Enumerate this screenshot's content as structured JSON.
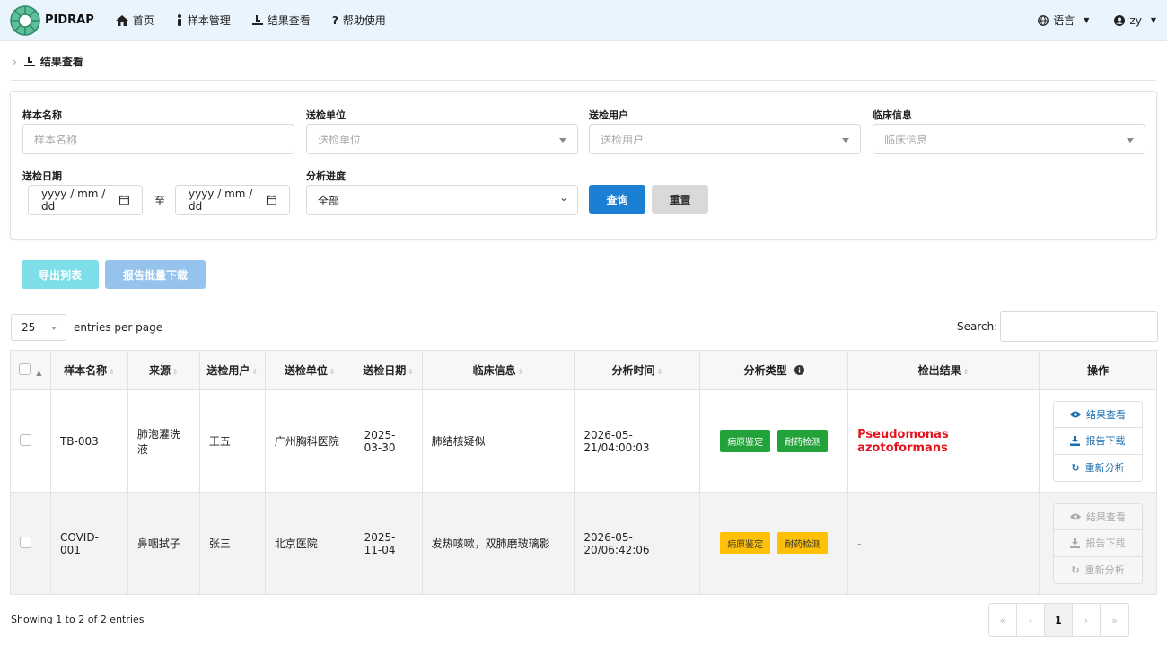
{
  "app": {
    "brand": "PIDRAP"
  },
  "nav": {
    "items": [
      {
        "label": "首页",
        "icon": "home-icon"
      },
      {
        "label": "样本管理",
        "icon": "sample-icon"
      },
      {
        "label": "结果查看",
        "icon": "result-icon"
      },
      {
        "label": "帮助使用",
        "icon": "help-icon"
      }
    ],
    "language": "语言",
    "user": "zy"
  },
  "breadcrumb": {
    "label": "结果查看"
  },
  "filters": {
    "sample_name_label": "样本名称",
    "sample_name_placeholder": "样本名称",
    "unit_label": "送检单位",
    "unit_placeholder": "送检单位",
    "user_label": "送检用户",
    "user_placeholder": "送检用户",
    "clinical_label": "临床信息",
    "clinical_placeholder": "临床信息",
    "date_label": "送检日期",
    "date_from": "yyyy / mm / dd",
    "date_sep": "至",
    "date_to": "yyyy / mm / dd",
    "progress_label": "分析进度",
    "progress_value": "全部",
    "query_button": "查询",
    "reset_button": "重置"
  },
  "actions": {
    "export": "导出列表",
    "batch_download": "报告批量下载"
  },
  "table_controls": {
    "page_size": "25",
    "entries_label": "entries per page",
    "search_label": "Search:"
  },
  "columns": [
    "样本名称",
    "来源",
    "送检用户",
    "送检单位",
    "送检日期",
    "临床信息",
    "分析时间",
    "分析类型",
    "检出结果",
    "操作"
  ],
  "rows": [
    {
      "name": "TB-003",
      "source": "肺泡灌洗液",
      "user": "王五",
      "unit": "广州胸科医院",
      "date": "2025-03-30",
      "clinical": "肺结核疑似",
      "time": "2026-05-21/04:00:03",
      "tags": [
        "病原鉴定",
        "耐药检测"
      ],
      "tag_color": "#21a33a",
      "result": "Pseudomonas azotoformans",
      "ops": [
        "结果查看",
        "报告下载",
        "重新分析"
      ]
    },
    {
      "name": "COVID-001",
      "source": "鼻咽拭子",
      "user": "张三",
      "unit": "北京医院",
      "date": "2025-11-04",
      "clinical": "发热咳嗽，双肺磨玻璃影",
      "time": "2026-05-20/06:42:06",
      "tags": [
        "病原鉴定",
        "耐药检测"
      ],
      "tag_color": "#ffc107",
      "result": "-",
      "ops": [
        "结果查看",
        "报告下载",
        "重新分析"
      ]
    }
  ],
  "footer": {
    "showing": "Showing 1 to 2 of 2 entries",
    "pager": [
      "«",
      "‹",
      "1",
      "›",
      "»"
    ]
  }
}
